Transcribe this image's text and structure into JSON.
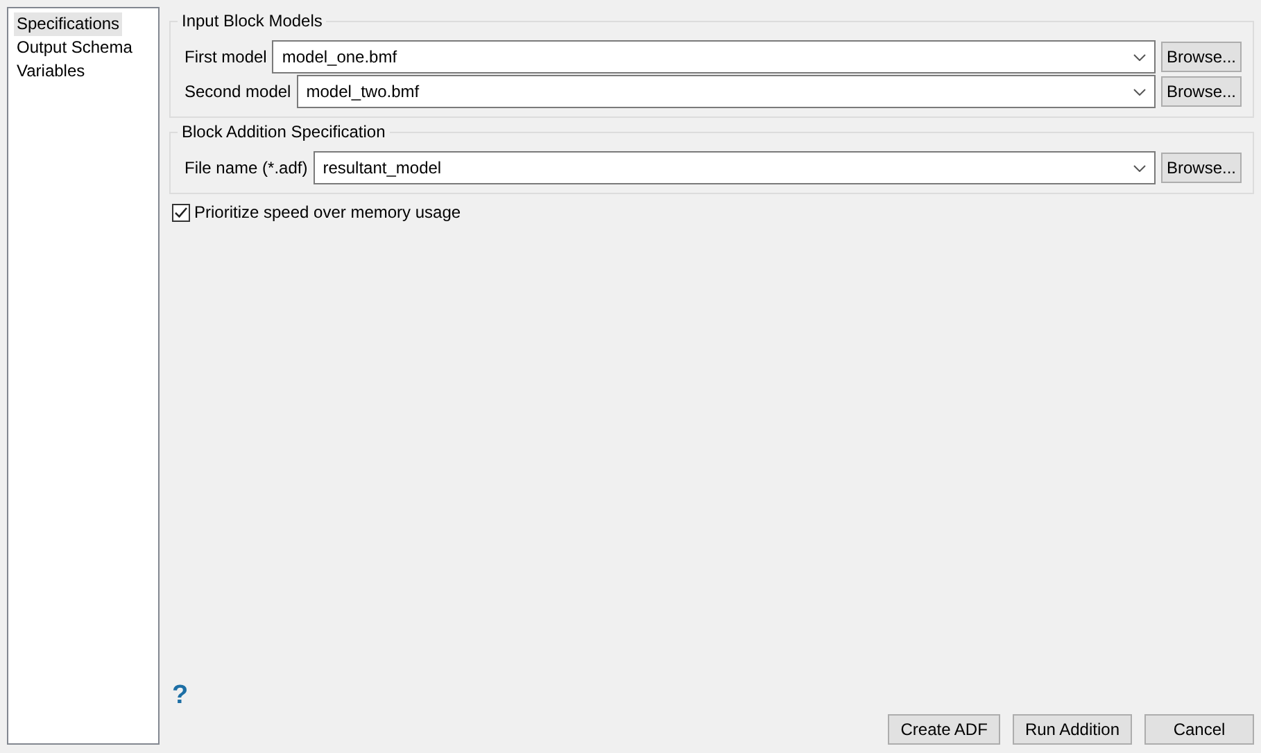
{
  "sidebar": {
    "items": [
      {
        "label": "Specifications",
        "selected": true
      },
      {
        "label": "Output Schema",
        "selected": false
      },
      {
        "label": "Variables",
        "selected": false
      }
    ]
  },
  "groups": [
    {
      "title": "Input Block Models",
      "fields": [
        {
          "label": "First model",
          "value": "model_one.bmf",
          "button": "Browse..."
        },
        {
          "label": "Second model",
          "value": "model_two.bmf",
          "button": "Browse..."
        }
      ]
    },
    {
      "title": "Block Addition Specification",
      "fields": [
        {
          "label": "File name (*.adf)",
          "value": "resultant_model",
          "button": "Browse..."
        }
      ]
    }
  ],
  "option": {
    "label": "Prioritize speed over memory usage",
    "checked": true
  },
  "help": "?",
  "buttons": [
    "Create ADF",
    "Run Addition",
    "Cancel"
  ]
}
